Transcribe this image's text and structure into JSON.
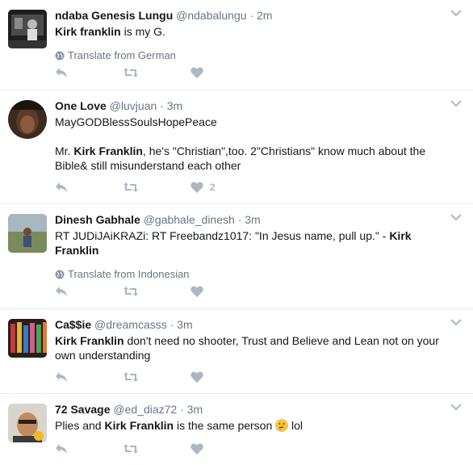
{
  "tweets": [
    {
      "name": "ndaba Genesis Lungu",
      "handle": "@ndabalungu",
      "sep": "·",
      "time": "2m",
      "text": [
        [
          "Kirk franklin",
          " is my G."
        ]
      ],
      "translate": "Translate from German",
      "likes": ""
    },
    {
      "name": "One Love",
      "handle": "@luvjuan",
      "sep": "·",
      "time": "3m",
      "p1": "MayGODBlessSoulsHopePeace",
      "p2_pre": "Mr. ",
      "p2_bold": "Kirk Franklin",
      "p2_post": ", he's \"Christian\",too. 2\"Christians\" know much about the Bible& still misunderstand each other",
      "likes": "2"
    },
    {
      "name": "Dinesh Gabhale",
      "handle": "@gabhale_dinesh",
      "sep": "·",
      "time": "3m",
      "pre": "RT JUDiJAiKRAZi: RT Freebandz1017: \"In Jesus name, pull up.\" - ",
      "bold": "Kirk Franklin",
      "translate": "Translate from Indonesian"
    },
    {
      "name": "Ca$$ie",
      "handle": "@dreamcasss",
      "sep": "·",
      "time": "3m",
      "bold": "Kirk Franklin",
      "post": " don't need no shooter, Trust and Believe and Lean not on your own understanding"
    },
    {
      "name": "72 Savage",
      "handle": "@ed_diaz72",
      "sep": "·",
      "time": "3m",
      "pre": "Plies and ",
      "bold": "Kirk Franklin",
      "mid": " is the same person ",
      "post": " lol"
    }
  ],
  "icons": {
    "reply": "reply-icon",
    "retweet": "retweet-icon",
    "like": "heart-icon",
    "more": "chevron-down-icon",
    "globe": "globe-icon"
  },
  "colors": {
    "text": "#14171a",
    "muted": "#657786",
    "icon": "#aab8c2",
    "divider": "#e6ecf0"
  }
}
